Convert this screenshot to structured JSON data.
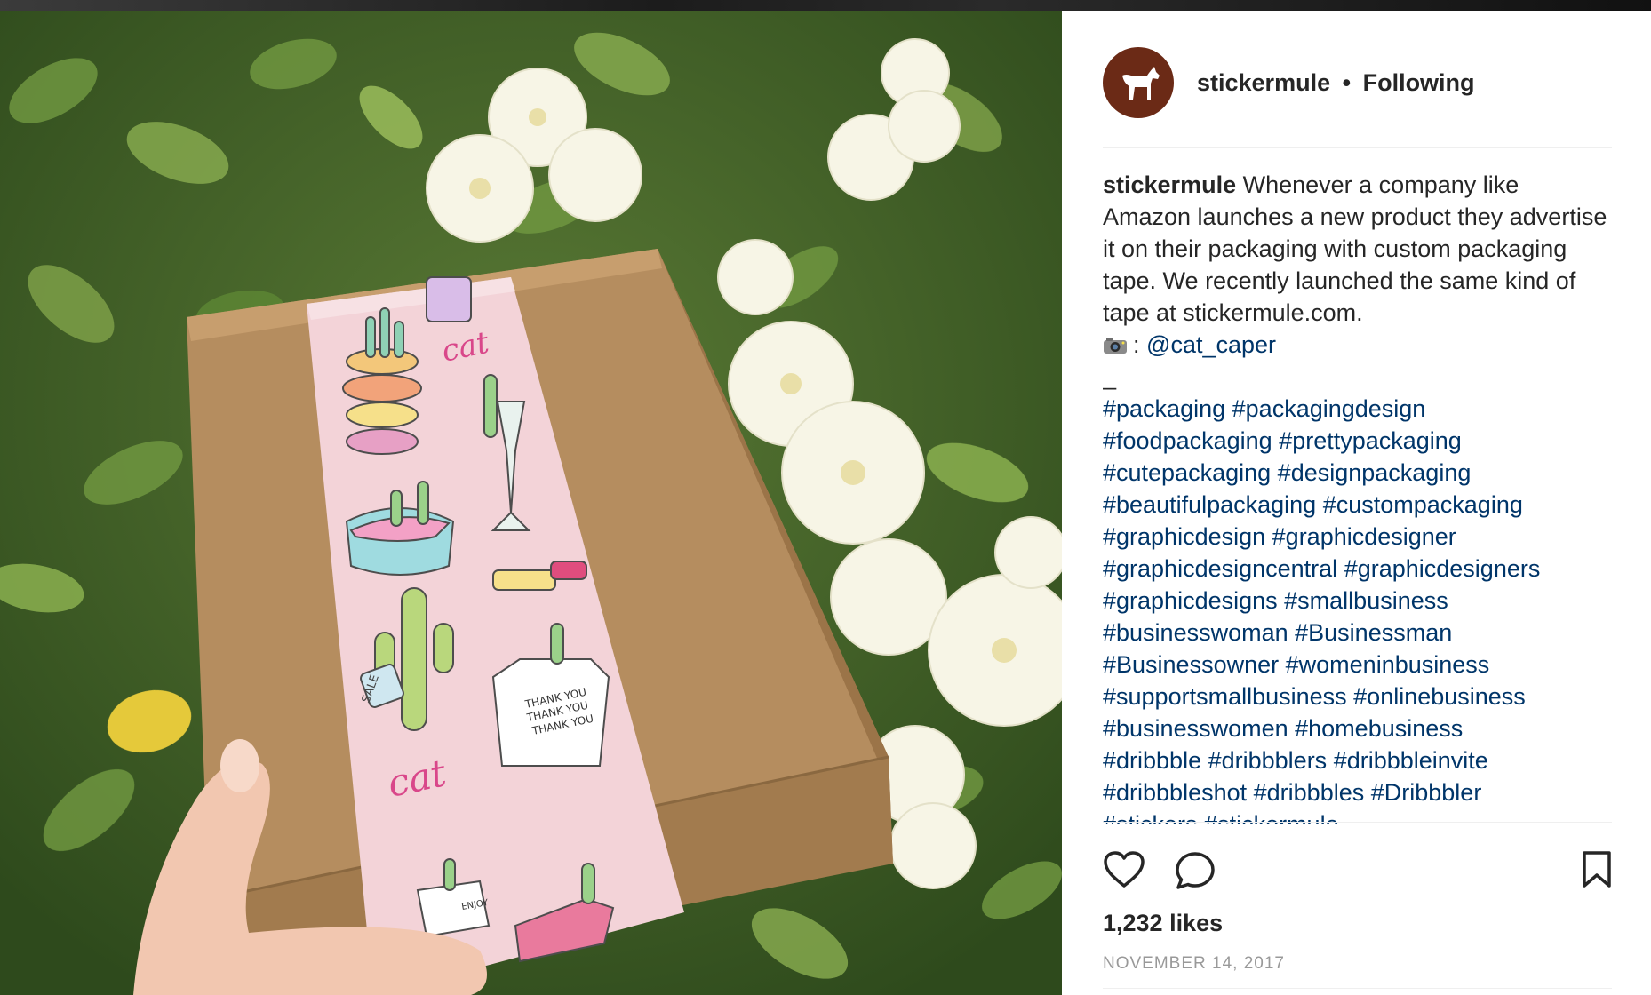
{
  "post": {
    "username": "stickermule",
    "separator": "•",
    "follow_status": "Following",
    "caption_user": "stickermule",
    "caption_text": "Whenever a company like Amazon launches a new product they advertise it on their packaging with custom packaging tape. We recently launched the same kind of tape at stickermule.com.",
    "credit_prefix": ":",
    "credit_handle": "@cat_caper",
    "dash": "_",
    "hashtags": [
      "#packaging",
      "#packagingdesign",
      "#foodpackaging",
      "#prettypackaging",
      "#cutepackaging",
      "#designpackaging",
      "#beautifulpackaging",
      "#custompackaging",
      "#graphicdesign",
      "#graphicdesigner",
      "#graphicdesigncentral",
      "#graphicdesigners",
      "#graphicdesigns",
      "#smallbusiness",
      "#businesswoman",
      "#Businessman",
      "#Businessowner",
      "#womeninbusiness",
      "#supportsmallbusiness",
      "#onlinebusiness",
      "#businesswomen",
      "#homebusiness",
      "#dribbble",
      "#dribbblers",
      "#dribbbleinvite",
      "#dribbbleshot",
      "#dribbbles",
      "#Dribbbler",
      "#stickers",
      "#stickermule"
    ],
    "likes": "1,232 likes",
    "date": "NOVEMBER 14, 2017"
  },
  "photo_text": {
    "tape_word_1": "cat",
    "tape_word_2": "cat",
    "tag_label": "SALE",
    "bag_line_1": "THANK YOU",
    "bag_line_2": "THANK YOU",
    "bag_line_3": "THANK YOU",
    "box_label": "ENJOY"
  },
  "icons": {
    "avatar": "horse-logo-icon",
    "like": "heart-icon",
    "comment": "comment-icon",
    "save": "bookmark-icon",
    "camera": "camera-emoji-icon"
  },
  "colors": {
    "avatar_bg": "#6b2a16",
    "link": "#003569",
    "text": "#262626",
    "muted": "#999999",
    "tape": "#f3d3d8"
  }
}
